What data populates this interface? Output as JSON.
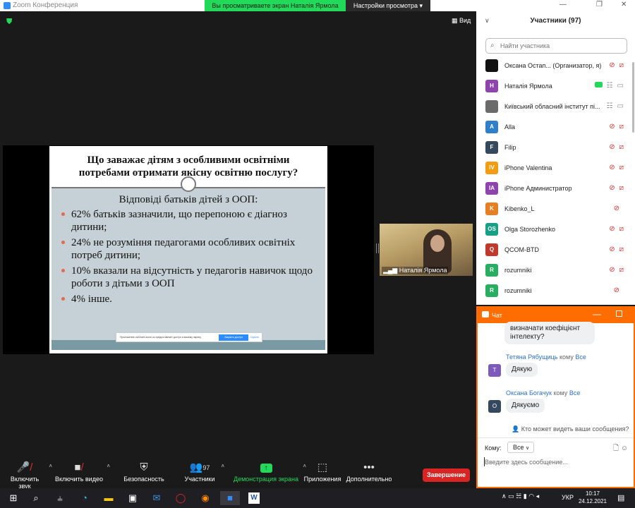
{
  "window": {
    "title": "Zoom Конференция",
    "share_banner": "Вы просматриваете экран Наталія Ярмола",
    "view_options": "Настройки просмотра ▾",
    "view_button": "Вид"
  },
  "slide": {
    "title_line1": "Що  заважає дітям з особливими освітніми",
    "title_line2": "потребами отримати якісну освітню послугу?",
    "subtitle": "Відповіді батьків дітей з ООП:",
    "bullets": [
      "62% батьків зазначили, що перепоною є діагноз дитини;",
      "24% не розуміння педагогами особливих освітніх потреб дитини;",
      "10% вказали на відсутність у педагогів навичок щодо роботи з дітьми з ООП",
      "4% інше."
    ],
    "notification": {
      "text": "Приложение us02web.zoom.us предоставляет доступ к вашему экрану.",
      "stop_button": "Закрыть доступ",
      "hide_button": "Скрыть"
    }
  },
  "video": {
    "name": "Наталія Ярмола"
  },
  "toolbar": {
    "audio": "Включить звук",
    "video": "Включить видео",
    "security": "Безопасность",
    "participants": "Участники",
    "participants_count": "97",
    "share": "Демонстрация экрана",
    "apps": "Приложения",
    "more": "Дополнительно",
    "end": "Завершение"
  },
  "participants": {
    "title": "Участники (97)",
    "search_placeholder": "Найти участника",
    "list": [
      {
        "initials": "",
        "name": "Оксана Остап... (Организатор, я)",
        "color": "#111111",
        "mic": "muted",
        "cam": "off"
      },
      {
        "initials": "Н",
        "name": "Наталія Ярмола",
        "color": "#8e44ad",
        "mic": "on",
        "cam": "on",
        "sharing": true
      },
      {
        "initials": "",
        "name": "Київський обласний інститут пі...",
        "color": "#6b6b6b",
        "mic": "on",
        "cam": "on"
      },
      {
        "initials": "A",
        "name": "Alla",
        "color": "#2f80c8",
        "mic": "muted",
        "cam": "off"
      },
      {
        "initials": "F",
        "name": "Filip",
        "color": "#34495e",
        "mic": "muted",
        "cam": "off"
      },
      {
        "initials": "IV",
        "name": "iPhone Valentina",
        "color": "#f39c12",
        "mic": "muted",
        "cam": "off"
      },
      {
        "initials": "IA",
        "name": "iPhone Администратор",
        "color": "#8e44ad",
        "mic": "muted",
        "cam": "off"
      },
      {
        "initials": "K",
        "name": "Kibenko_L",
        "color": "#e67e22",
        "mic": "muted",
        "cam": ""
      },
      {
        "initials": "OS",
        "name": "Olga  Storozhenko",
        "color": "#16a085",
        "mic": "muted",
        "cam": "off"
      },
      {
        "initials": "Q",
        "name": "QCOM-BTD",
        "color": "#c0392b",
        "mic": "muted",
        "cam": "off"
      },
      {
        "initials": "R",
        "name": "rozumniki",
        "color": "#27ae60",
        "mic": "muted",
        "cam": "off"
      },
      {
        "initials": "R",
        "name": "rozumniki",
        "color": "#27ae60",
        "mic": "muted",
        "cam": ""
      }
    ]
  },
  "chat": {
    "title": "Чат",
    "partial_message": "визначати коефіцієнт інтелекту?",
    "messages": [
      {
        "sender": "Тетяна Рябущиць",
        "to_word": "кому",
        "to": "Все",
        "initial": "Т",
        "color": "#7c5cb8",
        "text": "Дякую"
      },
      {
        "sender": "Оксана Богачук",
        "to_word": "кому",
        "to": "Все",
        "initial": "О",
        "color": "#34495e",
        "text": "Дякуємо"
      }
    ],
    "who_can_see": "Кто может видеть ваши сообщения?",
    "to_label": "Кому:",
    "to_value": "Все",
    "input_placeholder": "Введите здесь сообщение..."
  },
  "taskbar": {
    "language": "УКР",
    "time": "10:17",
    "date": "24.12.2021"
  },
  "colors": {
    "zoom_blue": "#2d8cff",
    "share_green": "#23d959",
    "end_red": "#d92424",
    "chat_orange": "#ff6d00"
  }
}
